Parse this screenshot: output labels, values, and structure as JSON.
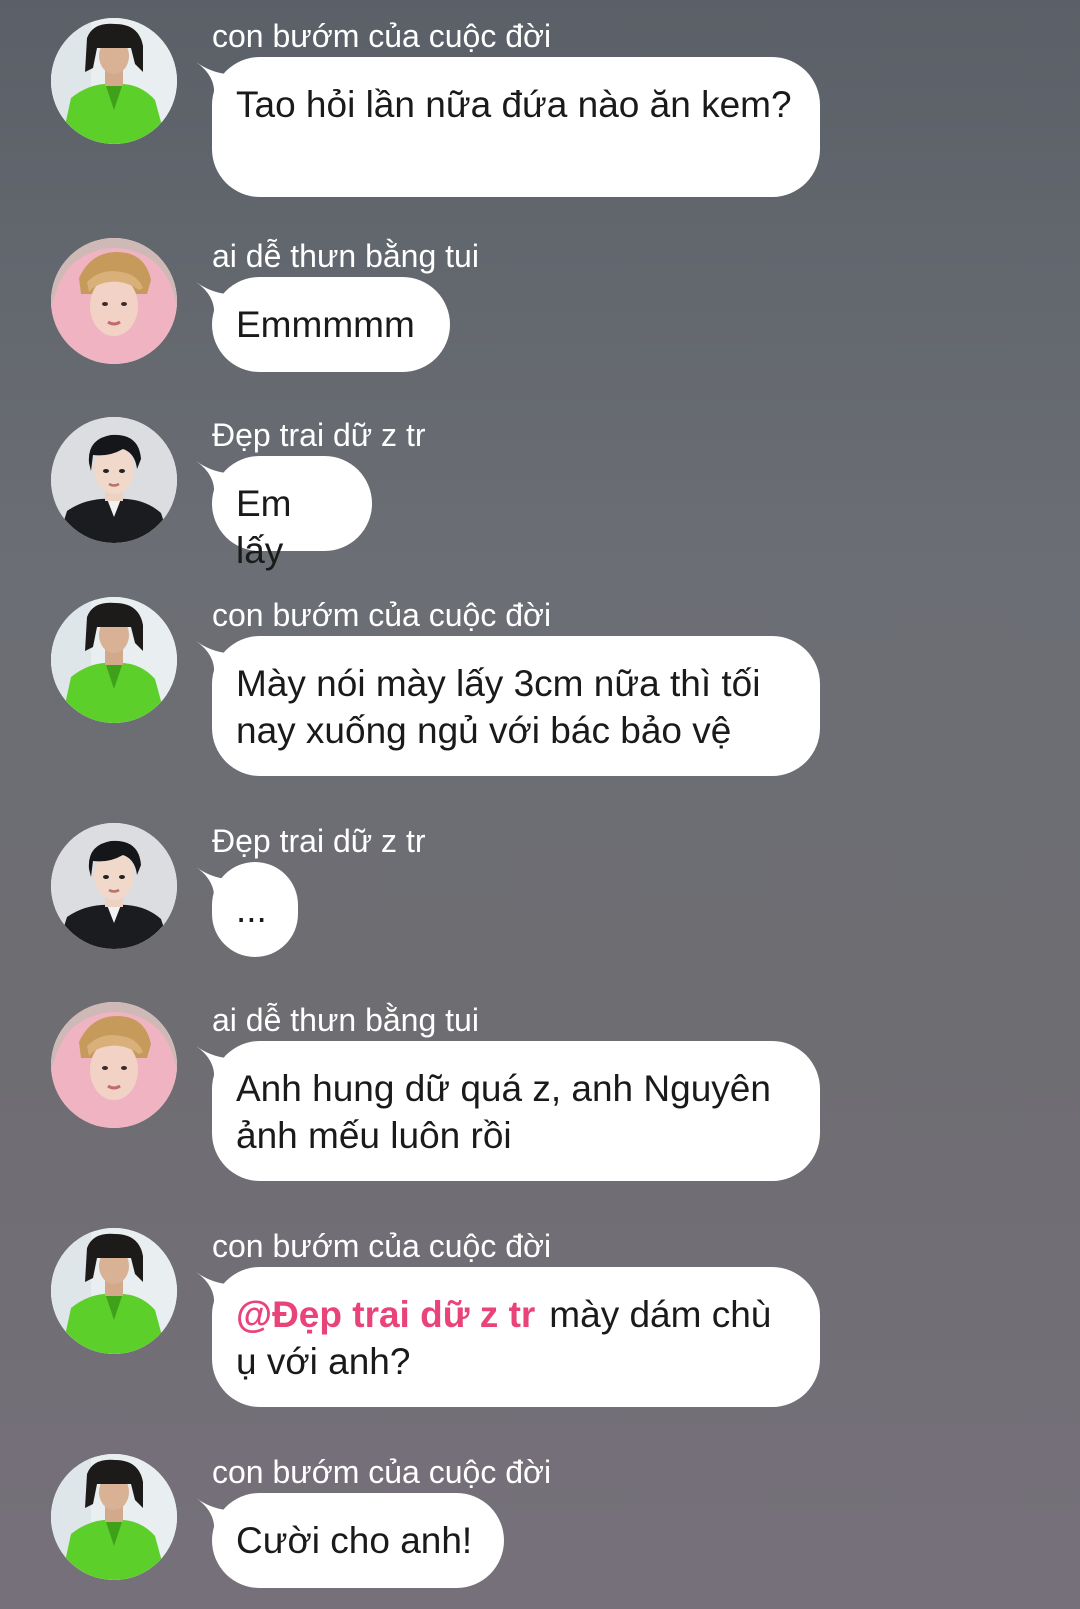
{
  "messages": [
    {
      "sender": "con bướm của cuộc đời",
      "avatar": "avatar-green-shirt",
      "text": "Tao hỏi lần nữa đứa nào ăn kem?"
    },
    {
      "sender": "ai dễ thưn bằng tui",
      "avatar": "avatar-pink-hoodie",
      "text": "Emmmmm"
    },
    {
      "sender": "Đẹp trai dữ z tr",
      "avatar": "avatar-black-jacket",
      "text": "Em lấy"
    },
    {
      "sender": "con bướm của cuộc đời",
      "avatar": "avatar-green-shirt",
      "text": "Mày nói mày lấy 3cm nữa thì tối nay xuống ngủ với bác bảo vệ"
    },
    {
      "sender": "Đẹp trai dữ z tr",
      "avatar": "avatar-black-jacket",
      "text": "..."
    },
    {
      "sender": "ai dễ thưn bằng tui",
      "avatar": "avatar-pink-hoodie",
      "text": "Anh hung dữ quá z, anh Nguyên ảnh mếu luôn rồi"
    },
    {
      "sender": "con bướm của cuộc đời",
      "avatar": "avatar-green-shirt",
      "mention": "@Đẹp trai dữ z tr",
      "text": "mày dám chù ụ với anh?"
    },
    {
      "sender": "con bướm của cuộc đời",
      "avatar": "avatar-green-shirt",
      "text": "Cười cho anh!"
    }
  ],
  "colors": {
    "mention": "#e8447a",
    "bubble": "#ffffff",
    "sender_name": "#ffffff"
  }
}
